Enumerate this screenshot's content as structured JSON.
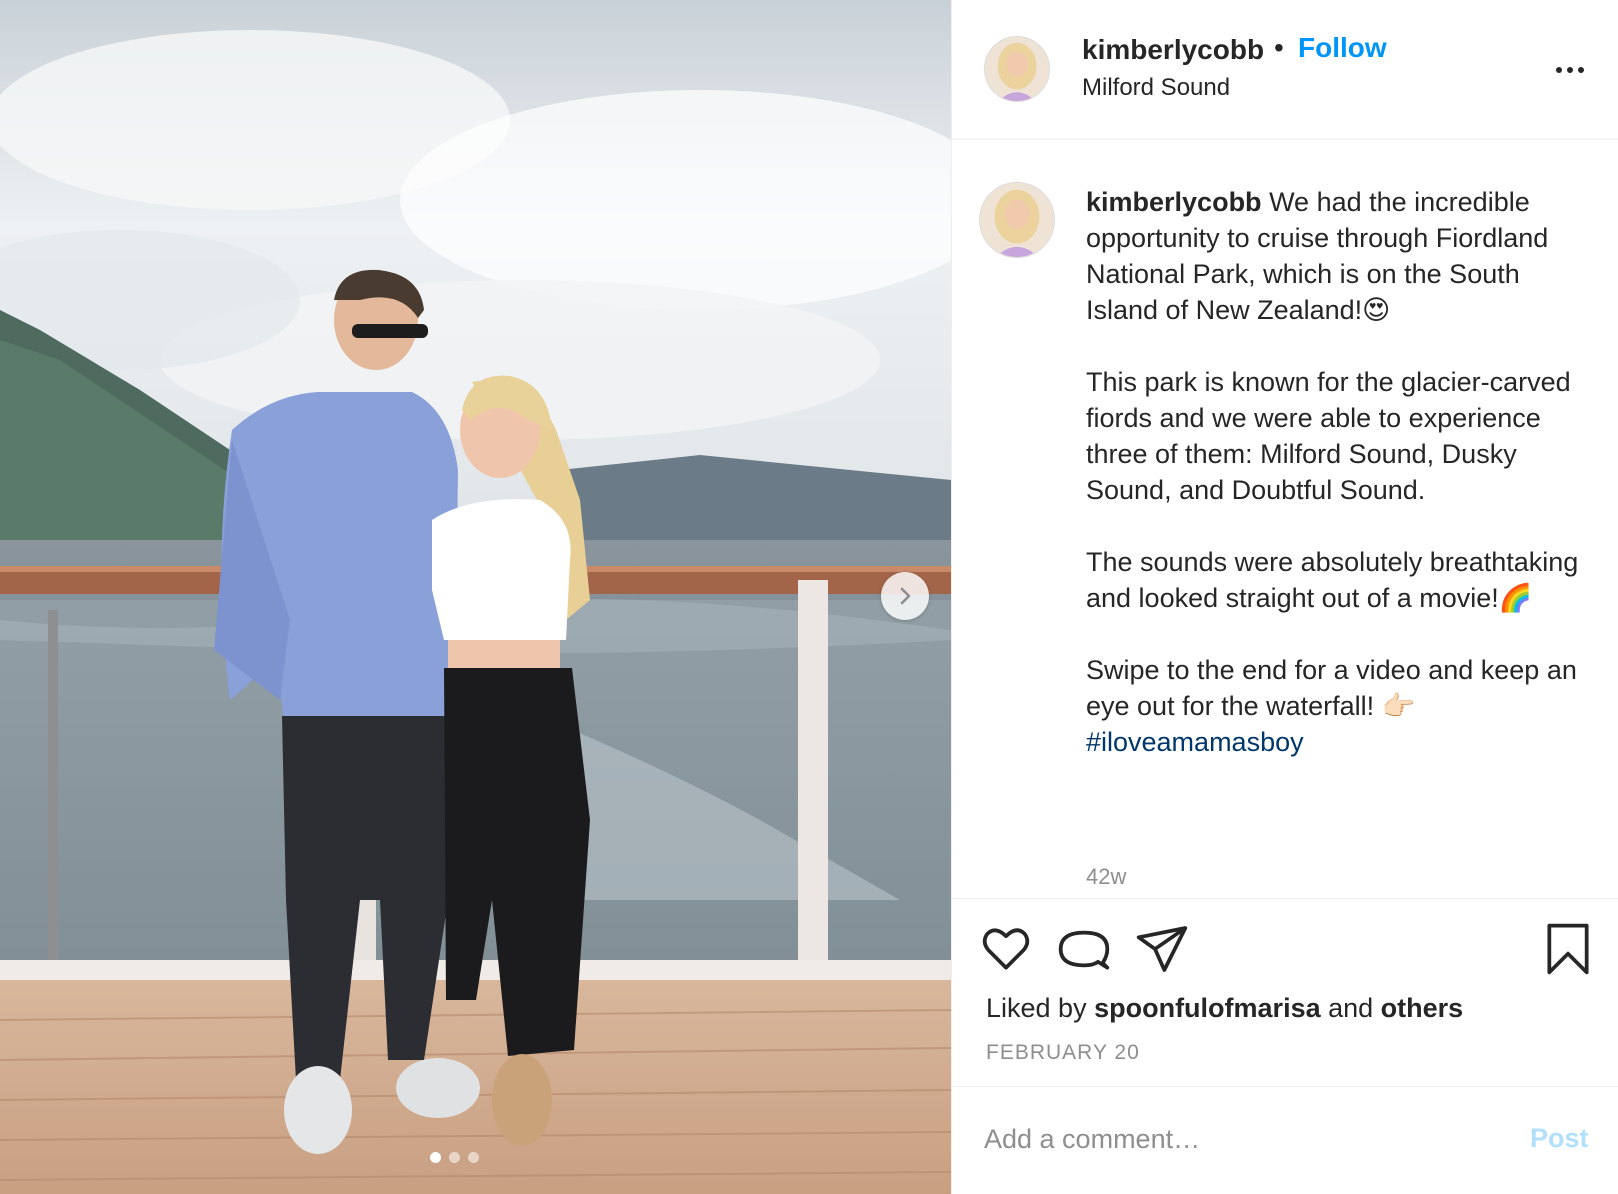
{
  "post": {
    "username": "kimberlycobb",
    "separator": "•",
    "follow_label": "Follow",
    "location": "Milford Sound",
    "caption_text": " We had the incredible opportunity to cruise through Fiordland National Park, which is on the South Island of New Zealand!😍\n\nThis park is known for the glacier-carved fiords and we were able to experience three of them: Milford Sound, Dusky Sound, and Doubtful Sound.\n\nThe sounds were absolutely breathtaking and looked straight out of a movie!🌈\n\nSwipe to the end for a video and keep an eye out for the waterfall! 👉🏻",
    "hashtag": "#iloveamamasboy",
    "age": "42w",
    "liked_prefix": "Liked by ",
    "liked_user": "spoonfulofmarisa",
    "liked_middle": " and ",
    "liked_others": "others",
    "date": "FEBRUARY 20"
  },
  "media": {
    "slide_count": 3,
    "active_slide": 1,
    "icons": {
      "next": "chevron-right-icon"
    }
  },
  "actions": {
    "icons": [
      "heart-icon",
      "comment-icon",
      "share-icon",
      "bookmark-icon"
    ]
  },
  "comment": {
    "placeholder": "Add a comment…",
    "post_label": "Post"
  },
  "colors": {
    "follow": "#0095f6",
    "hashtag": "#00376b",
    "post_disabled": "#b2dffc",
    "muted": "#8e8e8e"
  }
}
